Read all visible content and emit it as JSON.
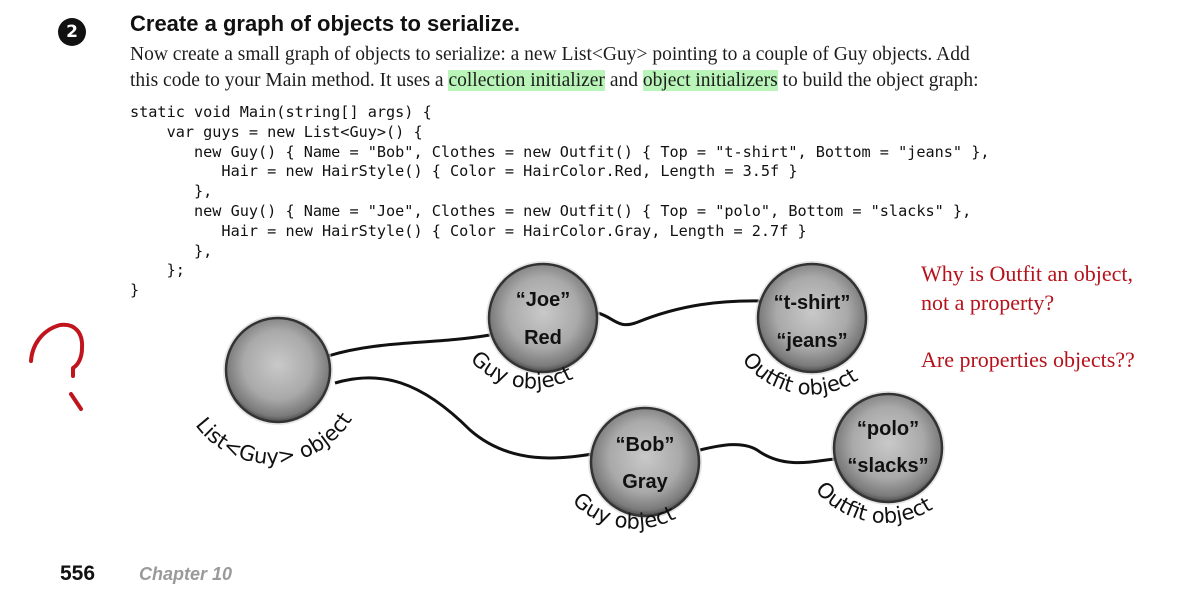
{
  "step": {
    "number": "2",
    "heading": "Create a graph of objects to serialize."
  },
  "intro": {
    "line1": "Now create a small graph of objects to serialize: a new List<Guy> pointing to a couple of Guy objects. Add",
    "line2_pre": "this code to your Main method. It uses a ",
    "highlight1": "collection initializer",
    "line2_mid": " and ",
    "highlight2": "object initializers",
    "line2_post": " to build the object graph:"
  },
  "code": {
    "lines": [
      "static void Main(string[] args) {",
      "    var guys = new List<Guy>() {",
      "       new Guy() { Name = \"Bob\", Clothes = new Outfit() { Top = \"t-shirt\", Bottom = \"jeans\" },",
      "          Hair = new HairStyle() { Color = HairColor.Red, Length = 3.5f }",
      "       },",
      "       new Guy() { Name = \"Joe\", Clothes = new Outfit() { Top = \"polo\", Bottom = \"slacks\" },",
      "          Hair = new HairStyle() { Color = HairColor.Gray, Length = 2.7f }",
      "       },",
      "    };",
      "}"
    ]
  },
  "diagram": {
    "nodes": {
      "list": {
        "label": "List<Guy> object",
        "lines": []
      },
      "guy_joe": {
        "label": "Guy object",
        "lines": [
          "“Joe”",
          "Red"
        ]
      },
      "outfit_tshirt": {
        "label": "Outfit object",
        "lines": [
          "“t-shirt”",
          "“jeans”"
        ]
      },
      "guy_bob": {
        "label": "Guy object",
        "lines": [
          "“Bob”",
          "Gray"
        ]
      },
      "outfit_polo": {
        "label": "Outfit object",
        "lines": [
          "“polo”",
          "“slacks”"
        ]
      }
    }
  },
  "annotations": {
    "note1_line1": "Why is Outfit an object,",
    "note1_line2": "not a property?",
    "note2": "Are properties objects??",
    "handwritten_mark": "question-mark",
    "color": "#b5121b"
  },
  "footer": {
    "page_number": "556",
    "chapter": "Chapter 10"
  }
}
